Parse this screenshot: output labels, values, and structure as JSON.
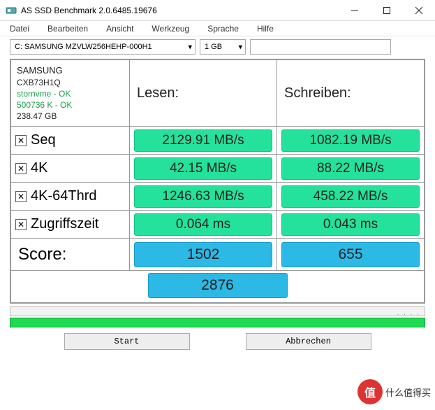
{
  "window": {
    "title": "AS SSD Benchmark 2.0.6485.19676"
  },
  "menu": {
    "datei": "Datei",
    "bearbeiten": "Bearbeiten",
    "ansicht": "Ansicht",
    "werkzeug": "Werkzeug",
    "sprache": "Sprache",
    "hilfe": "Hilfe"
  },
  "selectors": {
    "drive": "C: SAMSUNG MZVLW256HEHP-000H1",
    "size": "1 GB",
    "text": ""
  },
  "info": {
    "model": "SAMSUNG",
    "firmware": "CXB73H1Q",
    "driver": "stornvme - OK",
    "alignment": "500736 K - OK",
    "capacity": "238.47 GB"
  },
  "headers": {
    "read": "Lesen:",
    "write": "Schreiben:"
  },
  "rows": {
    "seq": {
      "label": "Seq",
      "read": "2129.91 MB/s",
      "write": "1082.19 MB/s"
    },
    "r4k": {
      "label": "4K",
      "read": "42.15 MB/s",
      "write": "88.22 MB/s"
    },
    "r4k64": {
      "label": "4K-64Thrd",
      "read": "1246.63 MB/s",
      "write": "458.22 MB/s"
    },
    "acc": {
      "label": "Zugriffszeit",
      "read": "0.064 ms",
      "write": "0.043 ms"
    }
  },
  "score": {
    "label": "Score:",
    "read": "1502",
    "write": "655",
    "total": "2876"
  },
  "buttons": {
    "start": "Start",
    "abort": "Abbrechen"
  },
  "watermark": {
    "symbol": "值",
    "text": "什么值得买"
  }
}
